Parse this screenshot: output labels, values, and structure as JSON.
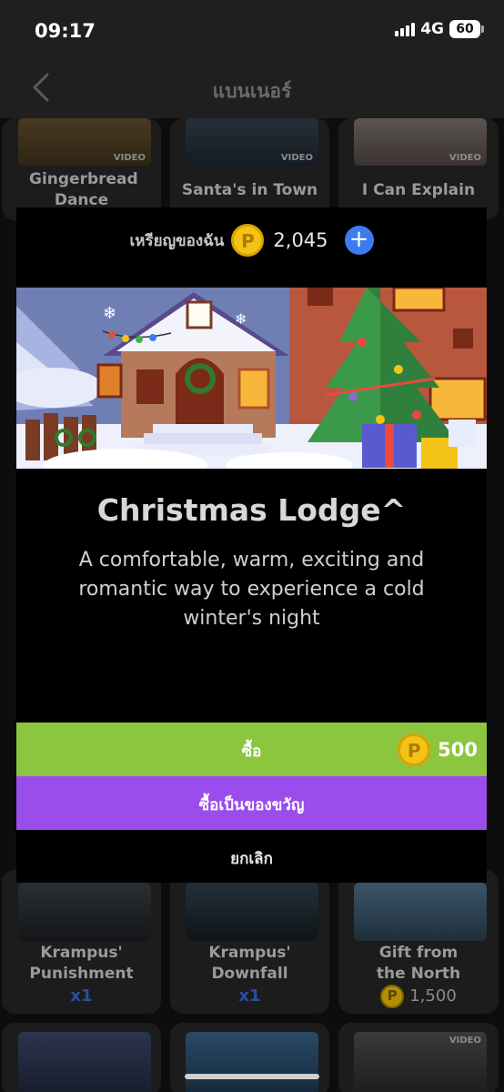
{
  "status_bar": {
    "time": "09:17",
    "network": "4G",
    "battery": "60"
  },
  "nav": {
    "title": "แบนเนอร์",
    "back_icon": "chevron-left-icon"
  },
  "background_tiles": {
    "row1": [
      {
        "name": "Gingerbread Dance",
        "tag": "VIDEO"
      },
      {
        "name": "Santa's in Town",
        "tag": "VIDEO"
      },
      {
        "name": "I Can Explain",
        "tag": "VIDEO"
      }
    ],
    "row3": [
      {
        "name": "Krampus' Punishment",
        "price": "x1"
      },
      {
        "name": "Krampus' Downfall",
        "price": "x1"
      },
      {
        "name": "Gift from the North",
        "price": "1,500"
      }
    ],
    "row4_tag": "VIDEO"
  },
  "modal": {
    "balance_label": "เหรียญของฉัน",
    "balance_value": "2,045",
    "plus_icon": "plus-icon",
    "title": "Christmas Lodge^",
    "description": "A comfortable, warm, exciting and romantic way to experience a cold winter's night",
    "buy_label": "ซื้อ",
    "buy_price": "500",
    "gift_label": "ซื้อเป็นของขวัญ",
    "cancel_label": "ยกเลิก"
  },
  "colors": {
    "buy_button": "#8cc63f",
    "gift_button": "#9b4deb",
    "plus_button": "#3d7bf0",
    "coin": "#f3c417"
  }
}
